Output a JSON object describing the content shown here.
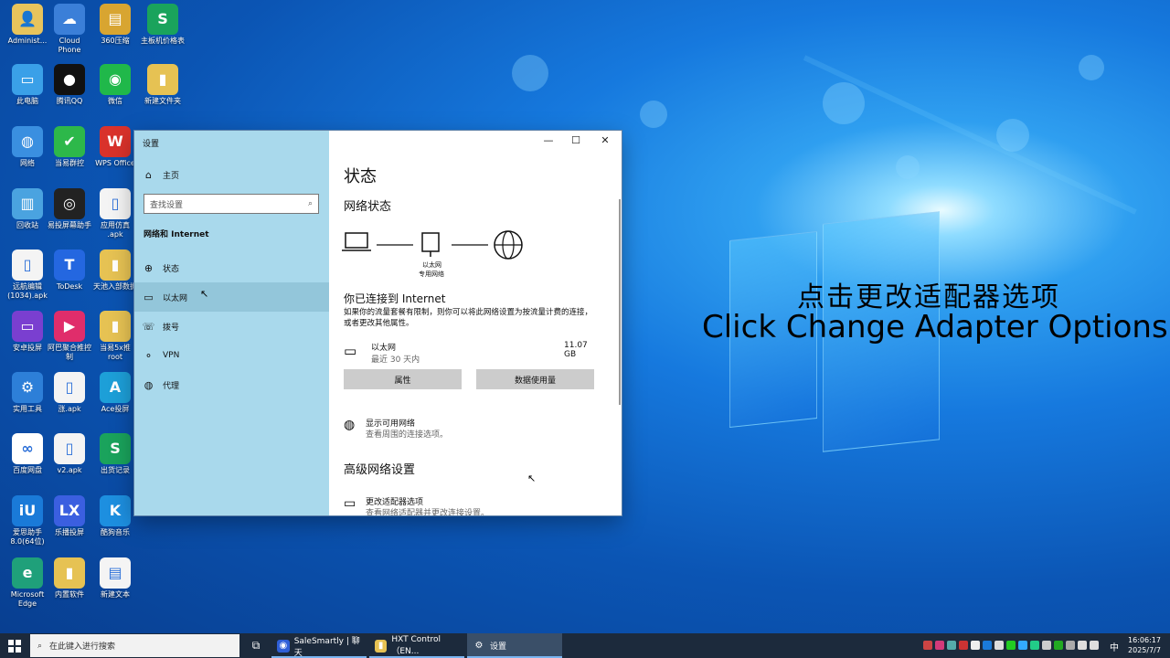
{
  "desktop_icons": [
    {
      "label": "Administ...",
      "color": "#e8c45c",
      "glyph": "👤"
    },
    {
      "label": "Cloud\nPhone",
      "color": "#3b7fd8",
      "glyph": "☁"
    },
    {
      "label": "360压缩",
      "color": "#d8a531",
      "glyph": "▤"
    },
    {
      "label": "主板机价格表",
      "color": "#1aa35c",
      "glyph": "S"
    },
    {
      "label": "此电脑",
      "color": "#3aa0e8",
      "glyph": "▭"
    },
    {
      "label": "腾讯QQ",
      "color": "#111111",
      "glyph": "●"
    },
    {
      "label": "微信",
      "color": "#20b84a",
      "glyph": "◉"
    },
    {
      "label": "新建文件夹",
      "color": "#e6c253",
      "glyph": "▮"
    },
    {
      "label": "网络",
      "color": "#3a8fe0",
      "glyph": "◍"
    },
    {
      "label": "当易群控",
      "color": "#2db84a",
      "glyph": "✔"
    },
    {
      "label": "WPS Office",
      "color": "#d9322b",
      "glyph": "W"
    },
    {
      "label": "",
      "color": "transparent",
      "glyph": ""
    },
    {
      "label": "回收站",
      "color": "#4aa3e0",
      "glyph": "▥"
    },
    {
      "label": "易投屏幕助手",
      "color": "#222222",
      "glyph": "◎"
    },
    {
      "label": "应用仿真\n.apk",
      "color": "#f4f4f4",
      "glyph": "▯"
    },
    {
      "label": "",
      "color": "transparent",
      "glyph": ""
    },
    {
      "label": "远航编辑\n(1034).apk",
      "color": "#f4f4f4",
      "glyph": "▯"
    },
    {
      "label": "ToDesk",
      "color": "#2467e0",
      "glyph": "T"
    },
    {
      "label": "天池入部数据",
      "color": "#e6c253",
      "glyph": "▮"
    },
    {
      "label": "",
      "color": "transparent",
      "glyph": ""
    },
    {
      "label": "安卓投屏",
      "color": "#7a3fd0",
      "glyph": "▭"
    },
    {
      "label": "阿巴聚合推控\n制",
      "color": "#e02d6b",
      "glyph": "▶"
    },
    {
      "label": "当易5x推\nroot",
      "color": "#e6c253",
      "glyph": "▮"
    },
    {
      "label": "",
      "color": "transparent",
      "glyph": ""
    },
    {
      "label": "实用工具",
      "color": "#2d7fd8",
      "glyph": "⚙"
    },
    {
      "label": "涨.apk",
      "color": "#f4f4f4",
      "glyph": "▯"
    },
    {
      "label": "Ace投屏",
      "color": "#1d9fd8",
      "glyph": "A"
    },
    {
      "label": "",
      "color": "transparent",
      "glyph": ""
    },
    {
      "label": "百度网盘",
      "color": "#ffffff",
      "glyph": "∞"
    },
    {
      "label": "v2.apk",
      "color": "#f4f4f4",
      "glyph": "▯"
    },
    {
      "label": "出货记录",
      "color": "#1aa35c",
      "glyph": "S"
    },
    {
      "label": "",
      "color": "transparent",
      "glyph": ""
    },
    {
      "label": "爱思助手\n8.0(64位)",
      "color": "#1a7ad8",
      "glyph": "iU"
    },
    {
      "label": "乐播投屏",
      "color": "#3b5fe0",
      "glyph": "LX"
    },
    {
      "label": "酷狗音乐",
      "color": "#1d8fe0",
      "glyph": "K"
    },
    {
      "label": "",
      "color": "transparent",
      "glyph": ""
    },
    {
      "label": "Microsoft\nEdge",
      "color": "#1fa07a",
      "glyph": "e"
    },
    {
      "label": "内置软件",
      "color": "#e6c253",
      "glyph": "▮"
    },
    {
      "label": "新建文本",
      "color": "#f4f4f4",
      "glyph": "▤"
    }
  ],
  "overlay": {
    "cn": "点击更改适配器选项",
    "en": "Click Change Adapter Options"
  },
  "window": {
    "title": "设置",
    "controls": {
      "minimize": "—",
      "maximize": "☐",
      "close": "✕"
    },
    "sidebar": {
      "home": "主页",
      "search_placeholder": "查找设置",
      "section": "网络和 Internet",
      "items": [
        {
          "label": "状态",
          "icon": "status-icon",
          "glyph": "⊕"
        },
        {
          "label": "以太网",
          "icon": "ethernet-icon",
          "glyph": "▭",
          "selected": true
        },
        {
          "label": "拨号",
          "icon": "dialup-icon",
          "glyph": "☏"
        },
        {
          "label": "VPN",
          "icon": "vpn-icon",
          "glyph": "⚬"
        },
        {
          "label": "代理",
          "icon": "proxy-icon",
          "glyph": "◍"
        }
      ]
    },
    "main": {
      "title": "状态",
      "network_status": "网络状态",
      "adapter_label": "以太网",
      "adapter_sub": "专用网络",
      "connected_title": "你已连接到 Internet",
      "connected_desc": "如果你的流量套餐有限制，则你可以将此网络设置为按流量计费的连接，或者更改其他属性。",
      "connection": {
        "name": "以太网",
        "sub": "最近 30 天内",
        "usage": "11.07 GB"
      },
      "buttons": {
        "properties": "属性",
        "data_usage": "数据使用量"
      },
      "show_networks": {
        "title": "显示可用网络",
        "desc": "查看周围的连接选项。"
      },
      "advanced_title": "高级网络设置",
      "change_adapter": {
        "title": "更改适配器选项",
        "desc": "查看网络适配器并更改连接设置。"
      }
    }
  },
  "taskbar": {
    "search_placeholder": "在此键入进行搜索",
    "apps": [
      {
        "label": "SaleSmartly | 聊天",
        "color": "#2f5fd8",
        "glyph": "◉"
      },
      {
        "label": "HXT Control（EN...",
        "color": "#e6c253",
        "glyph": "▮"
      },
      {
        "label": "设置",
        "color": "transparent",
        "glyph": "⚙"
      }
    ],
    "ime": "中",
    "time": "16:06:17",
    "date": "2025/7/7"
  }
}
